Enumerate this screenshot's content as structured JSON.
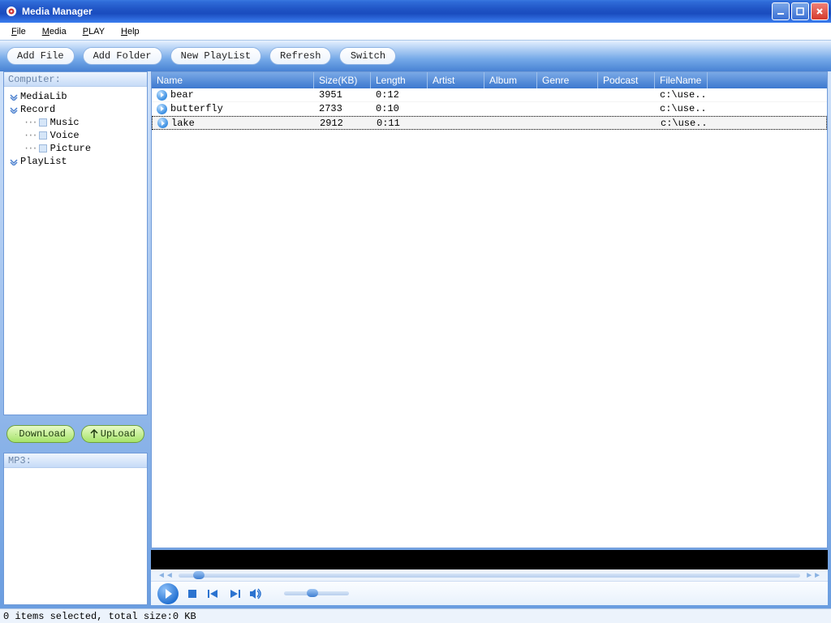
{
  "window": {
    "title": "Media Manager"
  },
  "menu": {
    "file": "File",
    "media": "Media",
    "play": "PLAY",
    "help": "Help"
  },
  "toolbar": {
    "add_file": "Add File",
    "add_folder": "Add Folder",
    "new_playlist": "New PlayList",
    "refresh": "Refresh",
    "switch": "Switch"
  },
  "sidebar": {
    "computer_header": "Computer:",
    "medialib": "MediaLib",
    "record": "Record",
    "music": "Music",
    "voice": "Voice",
    "picture": "Picture",
    "playlist": "PlayList",
    "download": "DownLoad",
    "upload": "UpLoad",
    "mp3_header": "MP3:"
  },
  "table": {
    "headers": {
      "name": "Name",
      "size": "Size(KB)",
      "length": "Length",
      "artist": "Artist",
      "album": "Album",
      "genre": "Genre",
      "podcast": "Podcast",
      "filename": "FileName"
    },
    "rows": [
      {
        "name": "bear",
        "size": "3951",
        "length": "0:12",
        "filename": "c:\\use..."
      },
      {
        "name": "butterfly",
        "size": "2733",
        "length": "0:10",
        "filename": "c:\\use..."
      },
      {
        "name": "lake",
        "size": "2912",
        "length": "0:11",
        "filename": "c:\\use..."
      }
    ],
    "selected_index": 2
  },
  "status": {
    "text": "0 items selected, total size:0 KB"
  }
}
